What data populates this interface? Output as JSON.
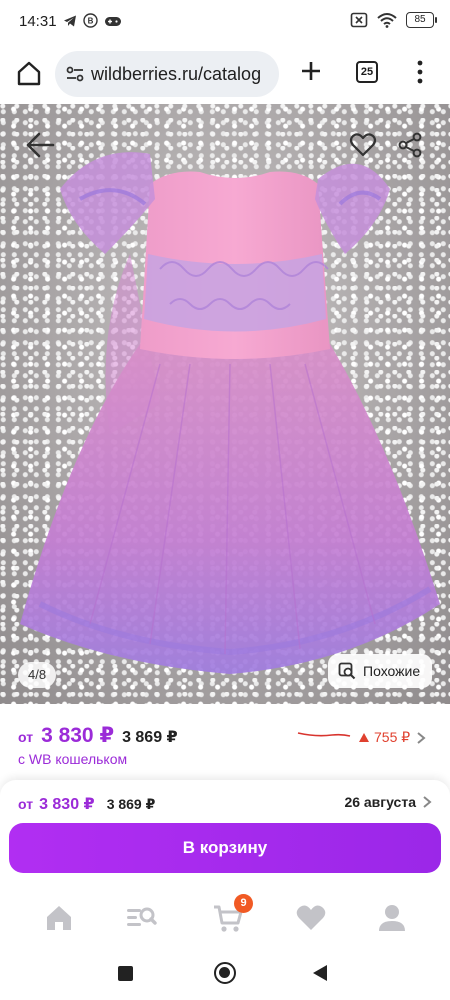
{
  "status_bar": {
    "time": "14:31",
    "battery": "85"
  },
  "browser": {
    "url": "wildberries.ru/catalog",
    "tab_count": "25"
  },
  "product_image": {
    "counter": "4/8",
    "similar_label": "Похожие"
  },
  "price": {
    "from_label": "от",
    "price": "3 830 ₽",
    "old_price": "3 869 ₽",
    "wallet_label": "с WB кошельком",
    "drop_value": "755 ₽"
  },
  "sheet": {
    "from_label": "от",
    "price": "3 830 ₽",
    "old_price": "3 869 ₽",
    "delivery_date": "26 августа",
    "cart_button": "В корзину"
  },
  "bottom_nav": {
    "cart_badge": "9",
    "items": [
      "home-icon",
      "catalog-search-icon",
      "cart-icon",
      "favorites-icon",
      "profile-icon"
    ]
  },
  "colors": {
    "accent": "#9b2bd8",
    "button": "#a92cf0",
    "drop": "#e0412f",
    "badge": "#f15a24"
  }
}
